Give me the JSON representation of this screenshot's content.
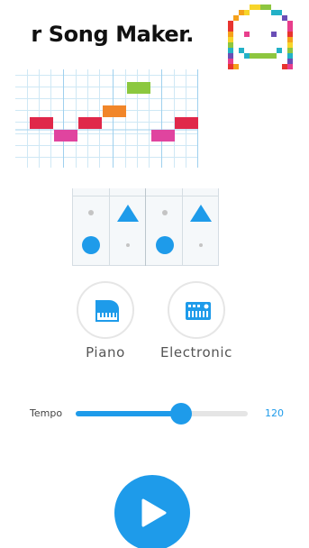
{
  "header": {
    "title": "r Song Maker."
  },
  "logo": {
    "icon": "smiley-pixel-icon",
    "colors": [
      "#e8342f",
      "#f5a11b",
      "#f7d52a",
      "#8dc63f",
      "#23b1c7",
      "#6a4eb6",
      "#e83e8c"
    ]
  },
  "melody_grid": {
    "notes": [
      {
        "col": 0,
        "row": 4,
        "color": "#e0284a"
      },
      {
        "col": 1,
        "row": 5,
        "color": "#e0449f"
      },
      {
        "col": 2,
        "row": 4,
        "color": "#e0284a"
      },
      {
        "col": 3,
        "row": 3,
        "color": "#f1862a"
      },
      {
        "col": 4,
        "row": 1,
        "color": "#8cc83f"
      },
      {
        "col": 5,
        "row": 5,
        "color": "#e0449f"
      },
      {
        "col": 6,
        "row": 4,
        "color": "#e0284a"
      }
    ]
  },
  "rhythm_grid": {
    "top": [
      "dot",
      "triangle",
      "dot",
      "triangle"
    ],
    "bottom": [
      "circle",
      "dot",
      "circle",
      "dot"
    ]
  },
  "instruments": [
    {
      "label": "Piano",
      "icon": "piano-icon"
    },
    {
      "label": "Electronic",
      "icon": "synth-icon"
    }
  ],
  "tempo": {
    "label": "Tempo",
    "value": "120",
    "level": 0.61
  },
  "play": {
    "icon": "play-icon"
  },
  "colors": {
    "accent": "#1e9bea"
  }
}
